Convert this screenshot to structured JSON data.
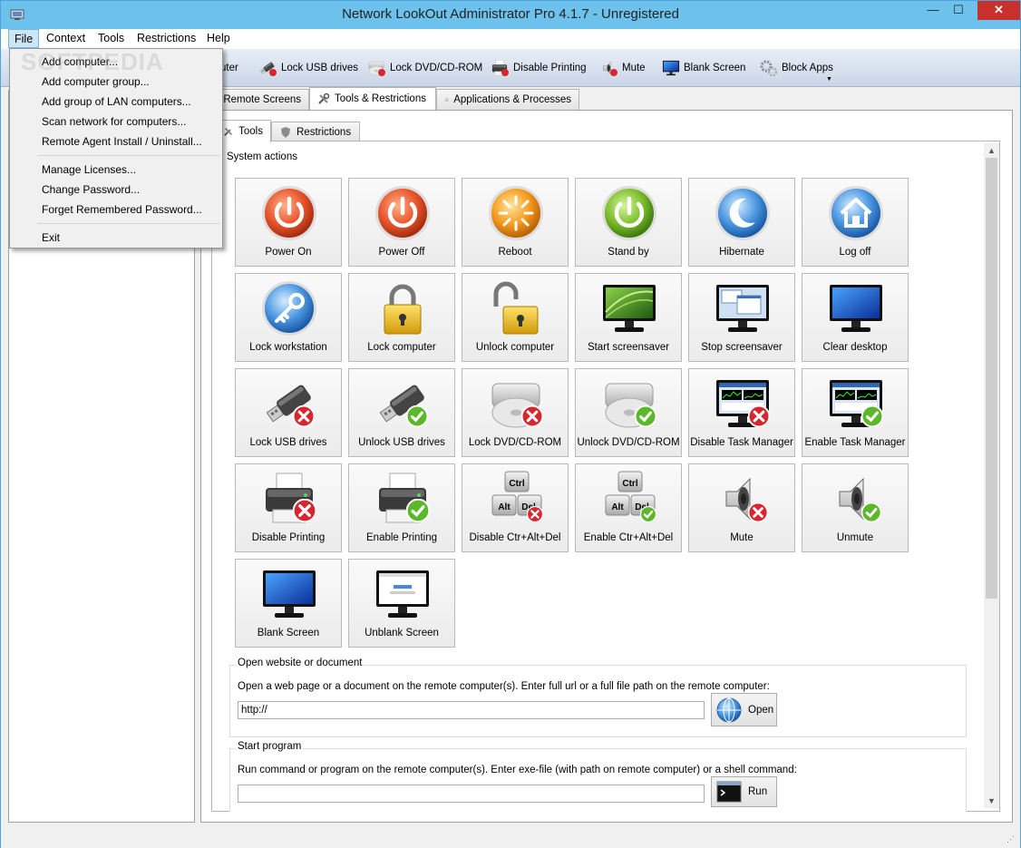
{
  "window": {
    "title": "Network LookOut Administrator Pro 4.1.7 - Unregistered",
    "min": "—",
    "max": "☐",
    "close": "✕"
  },
  "menubar": [
    "File",
    "Context",
    "Tools",
    "Restrictions",
    "Help"
  ],
  "file_menu": {
    "items": [
      "Add computer...",
      "Add computer group...",
      "Add group of LAN computers...",
      "Scan network for computers...",
      "Remote Agent Install / Uninstall...",
      "Manage Licenses...",
      "Change Password...",
      "Forget Remembered Password...",
      "Exit"
    ]
  },
  "watermark": "SOFTPEDIA",
  "toolbar": {
    "items": [
      "uter",
      "Lock USB drives",
      "Lock DVD/CD-ROM",
      "Disable Printing",
      "Mute",
      "Blank Screen",
      "Block Apps"
    ]
  },
  "tabs": {
    "main": [
      "Remote Screens",
      "Tools & Restrictions",
      "Applications & Processes"
    ],
    "sub": [
      "Tools",
      "Restrictions"
    ]
  },
  "system_actions": {
    "title": "System actions",
    "buttons": [
      "Power On",
      "Power Off",
      "Reboot",
      "Stand by",
      "Hibernate",
      "Log off",
      "Lock workstation",
      "Lock computer",
      "Unlock computer",
      "Start screensaver",
      "Stop screensaver",
      "Clear desktop",
      "Lock USB drives",
      "Unlock USB drives",
      "Lock DVD/CD-ROM",
      "Unlock DVD/CD-ROM",
      "Disable Task Manager",
      "Enable Task Manager",
      "Disable Printing",
      "Enable Printing",
      "Disable Ctr+Alt+Del",
      "Enable Ctr+Alt+Del",
      "Mute",
      "Unmute",
      "Blank Screen",
      "Unblank Screen"
    ]
  },
  "keys": {
    "ctrl": "Ctrl",
    "alt": "Alt",
    "del": "Del"
  },
  "open_website": {
    "title": "Open website or document",
    "description": "Open a web page or a document on the remote computer(s). Enter full url or a full file path on the remote computer:",
    "value": "http://",
    "button": "Open"
  },
  "start_program": {
    "title": "Start program",
    "description": "Run command or program on the remote computer(s). Enter exe-file (with path on remote computer) or a shell command:",
    "value": "",
    "button": "Run"
  },
  "colors": {
    "titlebar": "#6cc2ed",
    "close": "#c7302b",
    "menu_active": "#cde6f7"
  }
}
